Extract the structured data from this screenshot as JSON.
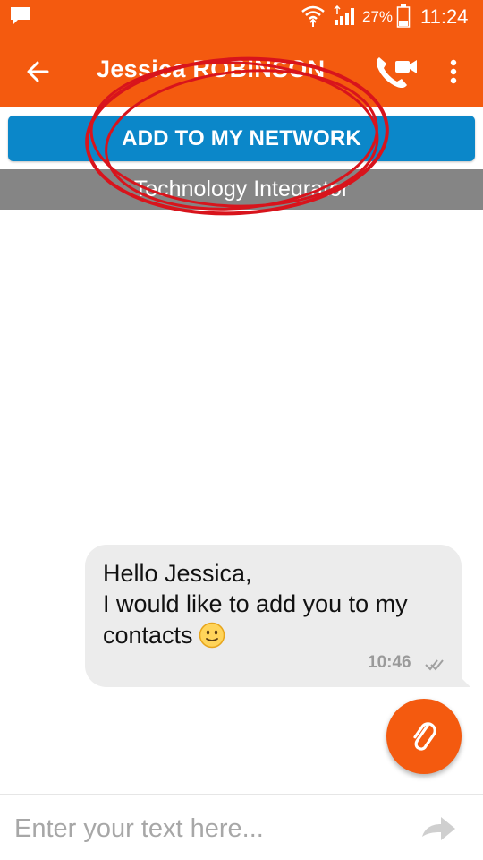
{
  "status_bar": {
    "battery_percent": "27%",
    "time": "11:24",
    "icons": [
      "notification-icon",
      "wifi-icon",
      "signal-icon",
      "battery-icon"
    ]
  },
  "app_bar": {
    "title": "Jessica ROBINSON",
    "icons": [
      "back-arrow-icon",
      "video-call-icon",
      "more-vert-icon"
    ]
  },
  "profile": {
    "add_button_label": "ADD TO MY NETWORK",
    "role": "Technology Integrator"
  },
  "messages": [
    {
      "lines": [
        "Hello Jessica,",
        "I would like to add you to my",
        "contacts"
      ],
      "emoji": "slight-smile-emoji",
      "time": "10:46",
      "status": "delivered-ticks-icon"
    }
  ],
  "composer": {
    "placeholder": "Enter your text here...",
    "icons": [
      "attachment-icon",
      "send-icon"
    ]
  },
  "colors": {
    "brand": "#f45a0f",
    "button": "#0b87c9",
    "role_bar": "#858585",
    "bubble": "#ececec",
    "annotation": "#d8141c"
  }
}
